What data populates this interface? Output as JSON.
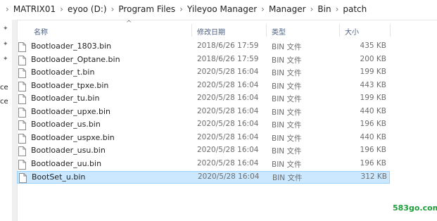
{
  "breadcrumb": [
    "MATRIX01",
    "eyoo (D:)",
    "Program Files",
    "Yileyoo Manager",
    "Manager",
    "Bin",
    "patch"
  ],
  "columns": {
    "name": "名称",
    "modified": "修改日期",
    "type": "类型",
    "size": "大小"
  },
  "sidebar_labels": [
    "ce",
    "ce"
  ],
  "files": [
    {
      "name": "Bootloader_1803.bin",
      "date": "2018/6/26 17:59",
      "type": "BIN 文件",
      "size": "435 KB"
    },
    {
      "name": "Bootloader_Optane.bin",
      "date": "2018/6/26 17:59",
      "type": "BIN 文件",
      "size": "200 KB"
    },
    {
      "name": "Bootloader_t.bin",
      "date": "2020/5/28 16:04",
      "type": "BIN 文件",
      "size": "199 KB"
    },
    {
      "name": "Bootloader_tpxe.bin",
      "date": "2020/5/28 16:04",
      "type": "BIN 文件",
      "size": "443 KB"
    },
    {
      "name": "Bootloader_tu.bin",
      "date": "2020/5/28 16:04",
      "type": "BIN 文件",
      "size": "199 KB"
    },
    {
      "name": "Bootloader_upxe.bin",
      "date": "2020/5/28 16:04",
      "type": "BIN 文件",
      "size": "440 KB"
    },
    {
      "name": "Bootloader_us.bin",
      "date": "2020/5/28 16:04",
      "type": "BIN 文件",
      "size": "196 KB"
    },
    {
      "name": "Bootloader_uspxe.bin",
      "date": "2020/5/28 16:04",
      "type": "BIN 文件",
      "size": "440 KB"
    },
    {
      "name": "Bootloader_usu.bin",
      "date": "2020/5/28 16:04",
      "type": "BIN 文件",
      "size": "196 KB"
    },
    {
      "name": "Bootloader_uu.bin",
      "date": "2020/5/28 16:04",
      "type": "BIN 文件",
      "size": "196 KB"
    },
    {
      "name": "BootSet_u.bin",
      "date": "2020/5/28 16:04",
      "type": "BIN 文件",
      "size": "312 KB",
      "selected": true
    }
  ],
  "watermark": "583go.com",
  "colors": {
    "selection": "#cce8ff",
    "selection_border": "#99d1ff",
    "header_text": "#4d6082",
    "watermark": "#1e9e3a"
  },
  "icons": {
    "pin": "pin-icon",
    "file": "file-icon",
    "folder": "folder-icon",
    "chevron": "chevron-right-icon"
  }
}
